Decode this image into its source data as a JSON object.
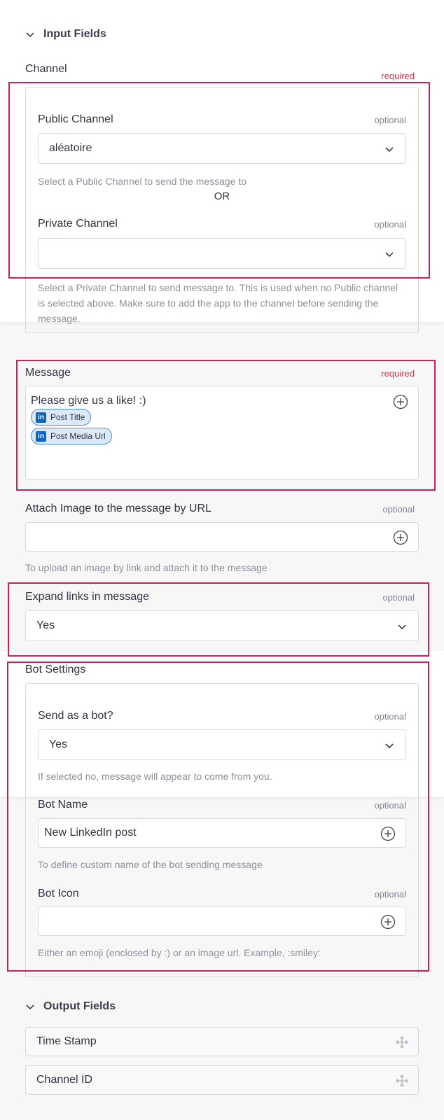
{
  "input_section": {
    "title": "Input Fields"
  },
  "channel": {
    "label": "Channel",
    "required": "required",
    "public": {
      "label": "Public Channel",
      "optional": "optional",
      "value": "aléatoire",
      "hint": "Select a Public Channel to send the message to"
    },
    "or_text": "OR",
    "private": {
      "label": "Private Channel",
      "optional": "optional",
      "value": "",
      "hint": "Select a Private Channel to send message to. This is used when no Public channel is selected above. Make sure to add the app to the channel before sending the message."
    }
  },
  "message": {
    "label": "Message",
    "required": "required",
    "text": "Please give us a like! :)",
    "tokens": [
      "Post Title",
      "Post Media Url"
    ],
    "token_icon": "in"
  },
  "attach_image": {
    "label": "Attach Image to the message by URL",
    "optional": "optional",
    "value": "",
    "hint": "To upload an image by link and attach it to the message"
  },
  "expand_links": {
    "label": "Expand links in message",
    "optional": "optional",
    "value": "Yes"
  },
  "bot_settings": {
    "label": "Bot Settings",
    "send_as_bot": {
      "label": "Send as a bot?",
      "optional": "optional",
      "value": "Yes",
      "hint": "If selected no, message will appear to come from you."
    },
    "bot_name": {
      "label": "Bot Name",
      "optional": "optional",
      "value": "New LinkedIn post",
      "hint": "To define custom name of the bot sending message"
    },
    "bot_icon": {
      "label": "Bot Icon",
      "optional": "optional",
      "value": "",
      "hint": "Either an emoji (enclosed by :) or an image url. Example, :smiley:"
    }
  },
  "output_section": {
    "title": "Output Fields",
    "fields": [
      "Time Stamp",
      "Channel ID"
    ]
  },
  "colors": {
    "highlight": "#cc1f5a",
    "required": "#e0344b",
    "linkedin": "#0a66c2"
  }
}
